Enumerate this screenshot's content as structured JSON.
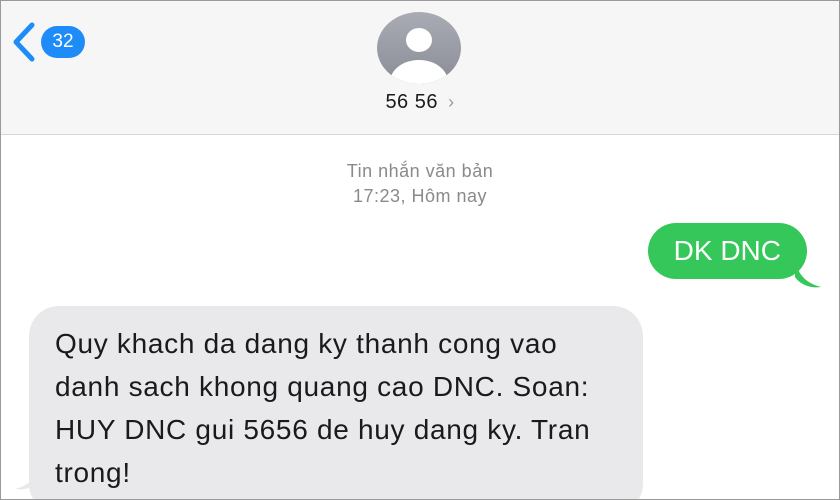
{
  "header": {
    "back_badge": "32",
    "contact_name": "56 56",
    "contact_chevron": "›"
  },
  "thread": {
    "service_label": "Tin nhắn văn bản",
    "timestamp": "17:23, Hôm nay"
  },
  "messages": [
    {
      "direction": "outgoing",
      "text": "DK DNC"
    },
    {
      "direction": "incoming",
      "text": "Quy khach da dang ky thanh cong vao danh sach khong quang cao DNC. Soan: HUY DNC gui 5656 de huy dang ky. Tran trong!"
    }
  ],
  "colors": {
    "accent": "#1e8cf8",
    "outgoing_bubble": "#35c759",
    "incoming_bubble": "#e9e9eb",
    "header_bg": "#f6f6f6"
  },
  "icons": {
    "back": "chevron-left-icon",
    "avatar": "person-avatar-icon"
  }
}
